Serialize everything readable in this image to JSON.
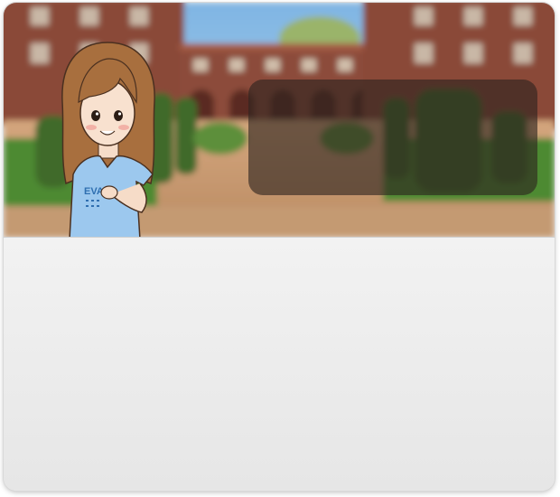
{
  "scene": {
    "background_name": "campus-courtyard",
    "colors": {
      "sky": "#7fb5e3",
      "brick": "#8a4a38",
      "hedge": "#3f6b2a",
      "path": "#c79a72"
    }
  },
  "character": {
    "shirt_text": "EVA",
    "shirt_color": "#9cc8ee",
    "hair_color": "#a86f3e"
  },
  "dialogue": {
    "text": ""
  },
  "panel": {
    "text": ""
  }
}
